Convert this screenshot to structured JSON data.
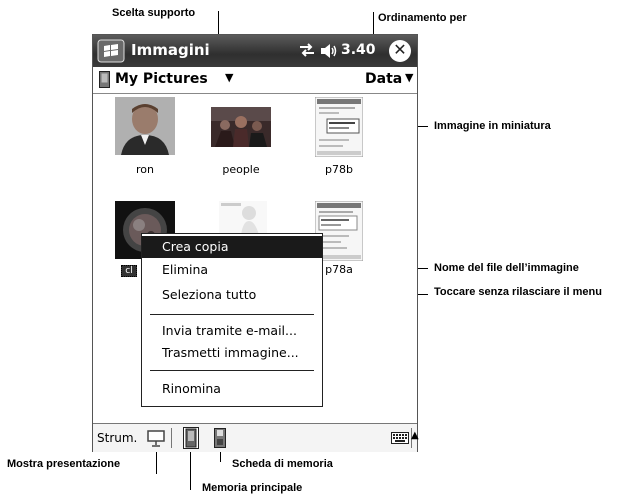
{
  "annotations": {
    "scelta_supporto": "Scelta supporto",
    "ordinamento_per": "Ordinamento per",
    "immagine_miniatura": "Immagine in miniatura",
    "nome_file": "Nome del file dell’immagine",
    "toccare_menu": "Toccare senza rilasciare il menu",
    "mostra_presentazione": "Mostra presentazione",
    "scheda_memoria": "Scheda di memoria",
    "memoria_principale": "Memoria principale"
  },
  "titlebar": {
    "title": "Immagini",
    "time": "3.40",
    "close_symbol": "✕",
    "icons": [
      "windows-start-icon",
      "connectivity-icon",
      "volume-icon",
      "close-icon"
    ]
  },
  "folderbar": {
    "folder": "My Pictures",
    "sort": "Data",
    "arrow": "▼"
  },
  "thumbnails": [
    {
      "caption": "ron"
    },
    {
      "caption": "people"
    },
    {
      "caption": "p78b"
    },
    {
      "caption": "cl"
    },
    {
      "caption": ""
    },
    {
      "caption": "p78a"
    }
  ],
  "context_menu": {
    "items": [
      "Crea copia",
      "Elimina",
      "Seleziona tutto",
      "Invia tramite e-mail...",
      "Trasmetti immagine...",
      "Rinomina"
    ],
    "selected": "Crea copia"
  },
  "toolbar": {
    "label": "Strum.",
    "up_arrow": "▲"
  },
  "colors": {
    "titlebar": "#3a3a3a",
    "menu_selected": "#1a1a1a"
  }
}
